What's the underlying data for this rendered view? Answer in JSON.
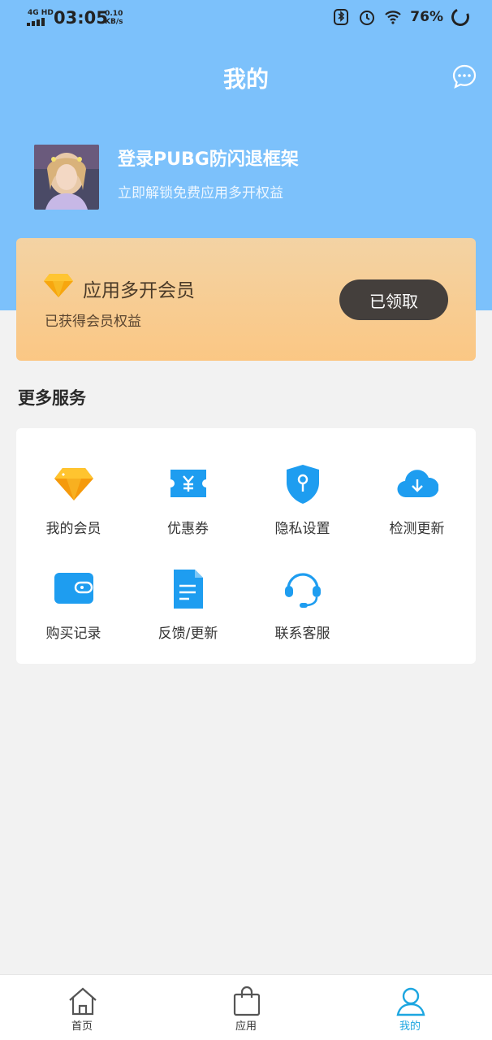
{
  "status_bar": {
    "network": "4G HD",
    "time": "03:05",
    "speed_value": "0.10",
    "speed_unit": "KB/s",
    "battery": "76%"
  },
  "header": {
    "title": "我的",
    "message_icon": "chat-bubble-icon"
  },
  "profile": {
    "name": "登录PUBG防闪退框架",
    "subtitle": "立即解锁免费应用多开权益"
  },
  "vip_card": {
    "icon": "diamond-icon",
    "title": "应用多开会员",
    "subtitle": "已获得会员权益",
    "button_label": "已领取",
    "accent": "#fbc784"
  },
  "services": {
    "title": "更多服务",
    "items": [
      {
        "label": "我的会员",
        "icon": "diamond-icon"
      },
      {
        "label": "优惠券",
        "icon": "coupon-icon"
      },
      {
        "label": "隐私设置",
        "icon": "shield-icon"
      },
      {
        "label": "检测更新",
        "icon": "cloud-download-icon"
      },
      {
        "label": "购买记录",
        "icon": "wallet-icon"
      },
      {
        "label": "反馈/更新",
        "icon": "document-icon"
      },
      {
        "label": "联系客服",
        "icon": "headset-icon"
      }
    ]
  },
  "tabbar": {
    "items": [
      {
        "label": "首页",
        "icon": "home-icon",
        "active": false
      },
      {
        "label": "应用",
        "icon": "shopping-bag-icon",
        "active": false
      },
      {
        "label": "我的",
        "icon": "user-icon",
        "active": true
      }
    ],
    "active_color": "#1da6e0"
  },
  "colors": {
    "header_bg": "#7cc1fb",
    "page_bg": "#f2f2f2",
    "icon_blue": "#1e9df0"
  }
}
